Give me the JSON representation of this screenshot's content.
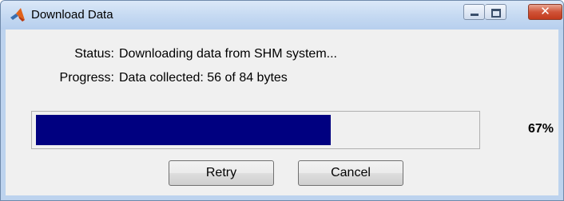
{
  "window": {
    "title": "Download Data",
    "icon": "matlab-logo-icon",
    "controls": [
      "minimize-icon",
      "maximize-icon",
      "close-icon"
    ]
  },
  "status": {
    "label": "Status:",
    "value": "Downloading data from SHM system..."
  },
  "progress": {
    "label": "Progress:",
    "value": "Data collected: 56 of 84 bytes",
    "fraction": 0.67,
    "percent_text": "67%",
    "fill_color": "#000080"
  },
  "buttons": {
    "retry": "Retry",
    "cancel": "Cancel"
  },
  "colors": {
    "titlebar": "#c6daf2",
    "panel": "#f0f0f0",
    "close_button": "#c94a2d"
  }
}
